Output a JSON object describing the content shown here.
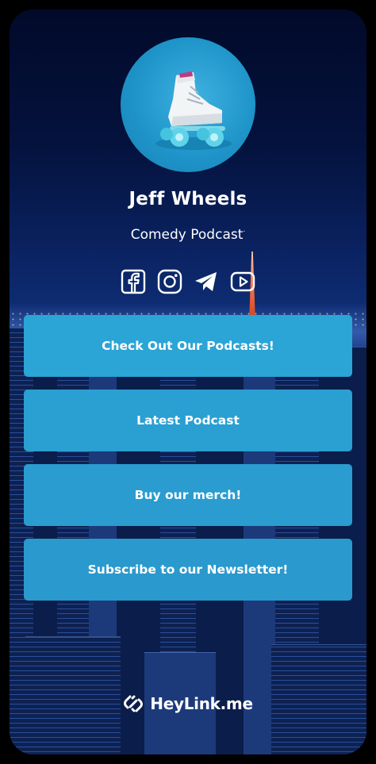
{
  "profile": {
    "name": "Jeff Wheels",
    "subtitle": "Comedy Podcast",
    "subtitle_mark": "·"
  },
  "socials": [
    {
      "name": "facebook-icon"
    },
    {
      "name": "instagram-icon"
    },
    {
      "name": "telegram-icon"
    },
    {
      "name": "youtube-icon"
    }
  ],
  "links": [
    {
      "label": "Check Out Our Podcasts!"
    },
    {
      "label": "Latest Podcast"
    },
    {
      "label": "Buy our merch!"
    },
    {
      "label": "Subscribe to our Newsletter!"
    }
  ],
  "footer": {
    "brand": "HeyLink.me"
  },
  "colors": {
    "button": "#2a9fd2",
    "text": "#ffffff",
    "background_top": "#020a2a",
    "background_bottom": "#1a3a6c"
  }
}
